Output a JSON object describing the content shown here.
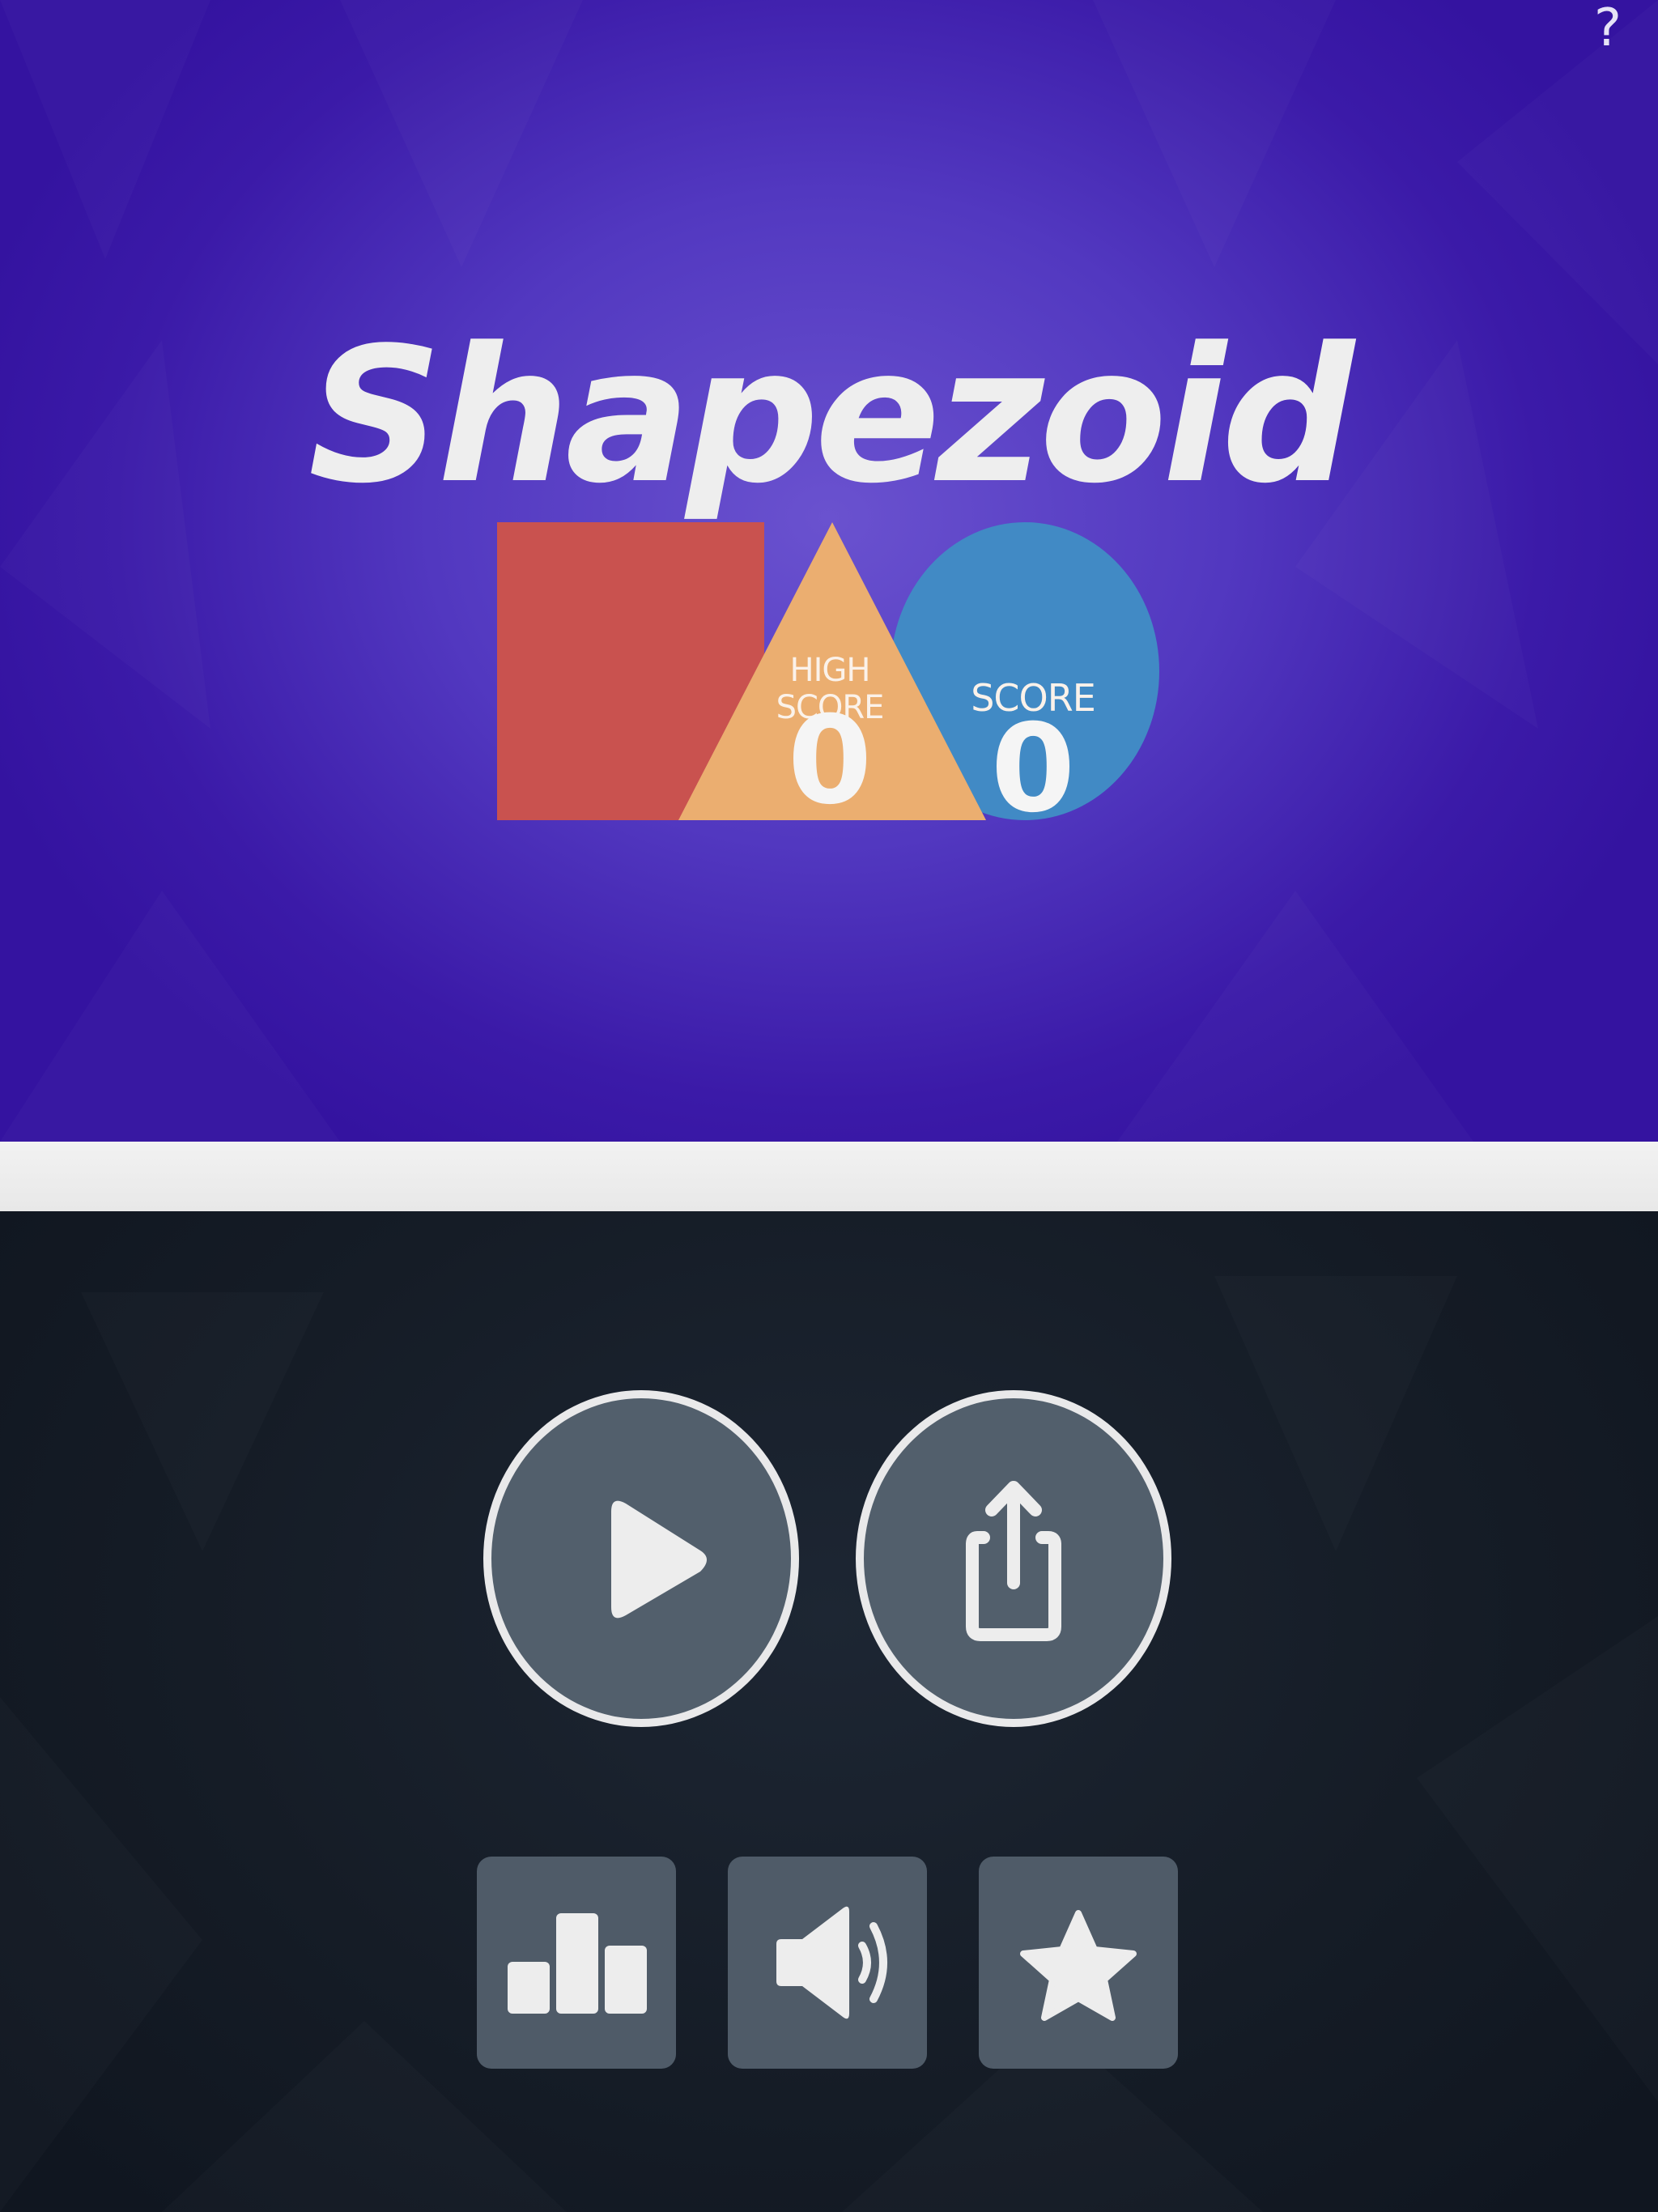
{
  "game": {
    "title": "Shapezoid",
    "help_label": "?"
  },
  "scores": {
    "high_score_label": "HIGH SCORE",
    "high_score_value": "0",
    "score_label": "SCORE",
    "score_value": "0"
  },
  "controls": {
    "play_icon": "play-icon",
    "share_icon": "share-icon",
    "leaderboard_icon": "leaderboard-icon",
    "sound_icon": "sound-icon",
    "rate_icon": "star-icon"
  },
  "colors": {
    "square": "#c9524f",
    "triangle": "#ebae70",
    "circle": "#418ac5",
    "top_bg": "#4e33bd",
    "bottom_bg": "#151c26"
  }
}
